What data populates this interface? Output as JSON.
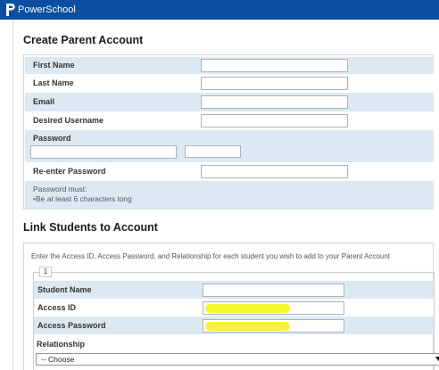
{
  "app": {
    "brand": "PowerSchool",
    "accent": "#0b4ea2"
  },
  "create_account": {
    "title": "Create Parent Account",
    "fields": {
      "first_name": "First Name",
      "last_name": "Last Name",
      "email": "Email",
      "desired_username": "Desired Username",
      "password": "Password",
      "reenter_password": "Re-enter Password"
    },
    "password_rules": {
      "heading": "Password must:",
      "rule_1": "•Be at least 6 characters long"
    }
  },
  "link_students": {
    "title": "Link Students to Account",
    "intro": "Enter the Access ID, Access Password, and Relationship for each student you wish to add to your Parent Account",
    "student_number": "1",
    "fields": {
      "student_name": "Student Name",
      "access_id": "Access ID",
      "access_password": "Access Password",
      "relationship": "Relationship"
    },
    "relationship_selected": "-- Choose"
  }
}
